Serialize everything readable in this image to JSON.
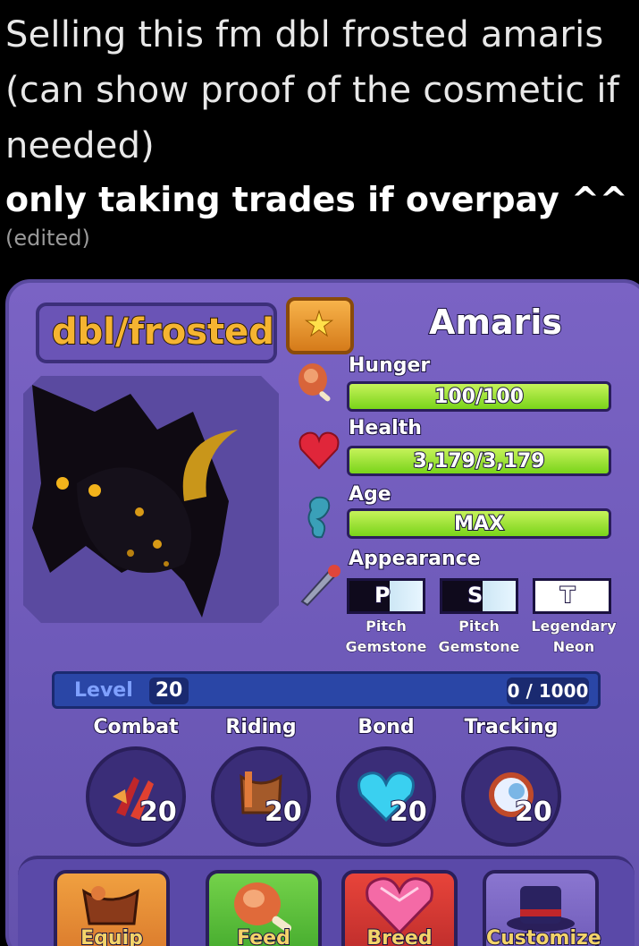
{
  "message": {
    "line1": "Selling this fm dbl frosted amaris",
    "line2": "(can show proof of the cosmetic if",
    "line3": "needed)",
    "bold_line": "only taking trades if overpay ^^",
    "edited": "(edited)"
  },
  "pet": {
    "nickname": "dbl/frosted",
    "species": "Amaris",
    "favorite_icon": "star-icon"
  },
  "stats": [
    {
      "label": "Hunger",
      "value": "100/100",
      "fill": 1.0,
      "icon": "drumstick-icon"
    },
    {
      "label": "Health",
      "value": "3,179/3,179",
      "fill": 1.0,
      "icon": "heart-icon"
    },
    {
      "label": "Age",
      "value": "MAX",
      "fill": 1.0,
      "icon": "seahorse-icon"
    }
  ],
  "appearance": {
    "label": "Appearance",
    "icon": "feather-horn-icon",
    "items": [
      {
        "letter": "P",
        "line1": "Pitch",
        "line2": "Gemstone"
      },
      {
        "letter": "S",
        "line1": "Pitch",
        "line2": "Gemstone"
      },
      {
        "letter": "T",
        "line1": "Legendary",
        "line2": "Neon"
      }
    ]
  },
  "level": {
    "label": "Level",
    "value": "20",
    "xp": "0 / 1000",
    "progress": 0.0
  },
  "skills": [
    {
      "label": "Combat",
      "value": "20",
      "icon": "claw-icon"
    },
    {
      "label": "Riding",
      "value": "20",
      "icon": "saddle-icon"
    },
    {
      "label": "Bond",
      "value": "20",
      "icon": "blue-heart-icon"
    },
    {
      "label": "Tracking",
      "value": "20",
      "icon": "eye-icon"
    }
  ],
  "actions": [
    {
      "label": "Equip",
      "icon": "saddle-icon",
      "color": "#e8892a"
    },
    {
      "label": "Feed",
      "icon": "drumstick-icon",
      "color": "#5bc03a"
    },
    {
      "label": "Breed",
      "icon": "gem-heart-icon",
      "color": "#d63a3a"
    },
    {
      "label": "Customize",
      "icon": "top-hat-icon",
      "color": "#7a66c2"
    }
  ]
}
